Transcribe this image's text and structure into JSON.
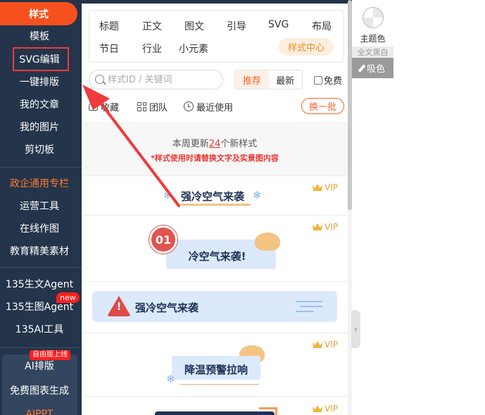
{
  "sidebar": {
    "top_label": "样式",
    "items": [
      "模板",
      "SVG编辑",
      "一键排版",
      "我的文章",
      "我的图片",
      "剪切板",
      "政企通用专栏",
      "运营工具",
      "在线作图",
      "教育精美素材",
      "135生文Agent",
      "135生图Agent",
      "135AI工具",
      "AI排版",
      "免费图表生成",
      "AIPPT"
    ],
    "new_badge": "new",
    "online_badge": "自由版上线"
  },
  "categories": [
    "标题",
    "正文",
    "图文",
    "引导",
    "SVG",
    "布局",
    "节日",
    "行业",
    "小元素"
  ],
  "style_center": "样式中心",
  "search": {
    "placeholder": "样式ID / 关键词"
  },
  "sort": {
    "recommend": "推荐",
    "latest": "最新"
  },
  "free_label": "免费",
  "filters": {
    "favorites": "收藏",
    "team": "团队",
    "recent": "最近使用"
  },
  "refresh": "换一批",
  "notice": {
    "prefix": "本周更新",
    "count": "24",
    "suffix": "个新样式",
    "tip": "*样式使用时请替换文字及实景图内容"
  },
  "vip_label": "VIP",
  "cards": {
    "c1": "强冷空气来袭",
    "c2_num": "01",
    "c2": "冷空气来袭!",
    "c3": "强冷空气来袭",
    "c4": "降温预警拉响"
  },
  "right": {
    "theme_color": "主题色",
    "full_bw": "全文黑白",
    "picker": "吸色"
  },
  "colors": {
    "accent": "#f5501e",
    "sidebar": "#24344a",
    "annotation": "#ef3b3b"
  }
}
